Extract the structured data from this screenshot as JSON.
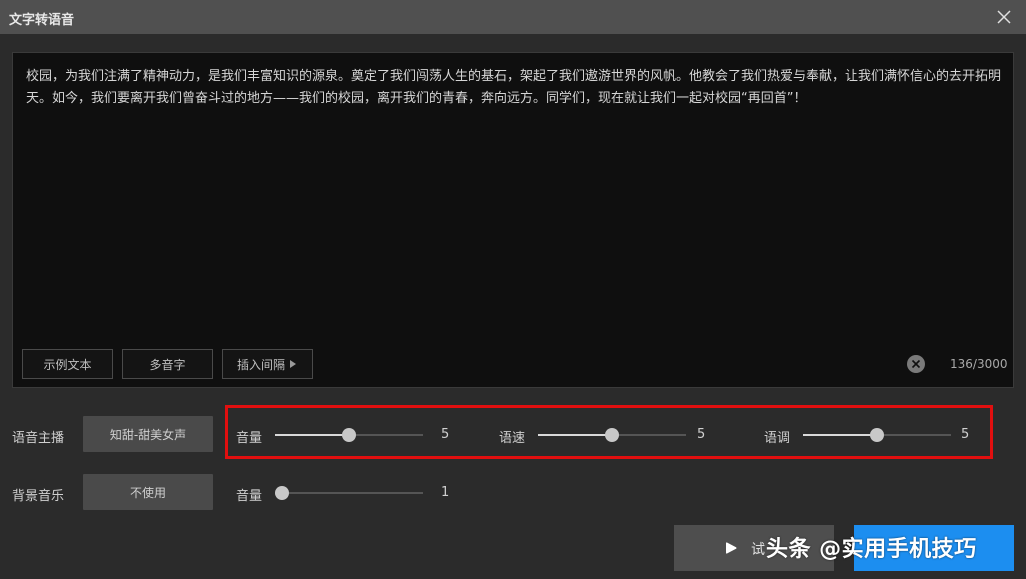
{
  "window": {
    "title": "文字转语音"
  },
  "editor": {
    "text": "校园，为我们注满了精神动力，是我们丰富知识的源泉。奠定了我们闯荡人生的基石，架起了我们遨游世界的风帆。他教会了我们热爱与奉献，让我们满怀信心的去开拓明天。如今，我们要离开我们曾奋斗过的地方——我们的校园，离开我们的青春，奔向远方。同学们，现在就让我们一起对校园“再回首”！",
    "buttons": {
      "sample": "示例文本",
      "polyphone": "多音字",
      "insert_pause": "插入间隔"
    },
    "char_count": "136/3000"
  },
  "voice": {
    "label": "语音主播",
    "selected": "知甜-甜美女声",
    "volume": {
      "label": "音量",
      "value": "5",
      "fraction": 0.5
    },
    "speed": {
      "label": "语速",
      "value": "5",
      "fraction": 0.5
    },
    "pitch": {
      "label": "语调",
      "value": "5",
      "fraction": 0.5
    }
  },
  "bgm": {
    "label": "背景音乐",
    "selected": "不使用",
    "volume": {
      "label": "音量",
      "value": "1",
      "fraction": 0.0
    }
  },
  "actions": {
    "preview_label": "试"
  },
  "watermark": {
    "text": "头条 @实用手机技巧"
  },
  "colors": {
    "accent": "#1c8ef0",
    "highlight": "#e10f0f"
  },
  "icons": {
    "close": "close-icon",
    "play": "play-icon",
    "clear": "clear-icon",
    "arrow": "triangle-right-icon"
  }
}
